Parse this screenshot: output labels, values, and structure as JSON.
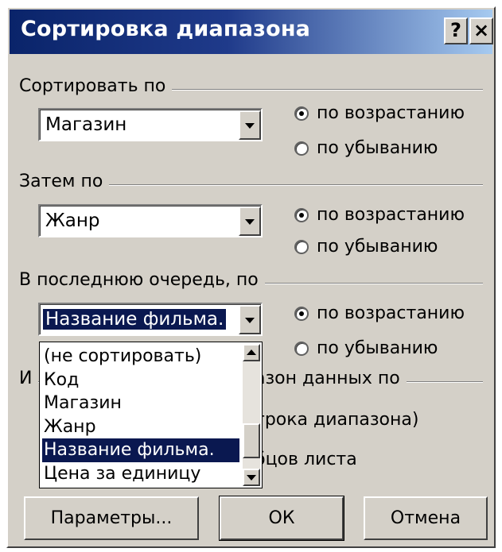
{
  "dialog": {
    "title": "Сортировка диапазона",
    "help_button": "?",
    "close_button": "×"
  },
  "sort_by": {
    "label": "Сортировать по",
    "value": "Магазин",
    "asc": "по возрастанию",
    "desc": "по убыванию",
    "selected": "asc"
  },
  "then_by": {
    "label": "Затем по",
    "value": "Жанр",
    "asc": "по возрастанию",
    "desc": "по убыванию",
    "selected": "asc"
  },
  "finally_by": {
    "label": "В последнюю очередь, по",
    "value": "Название фильма.",
    "asc": "по возрастанию",
    "desc": "по убыванию",
    "selected": "asc"
  },
  "identify": {
    "label_prefix": "И",
    "label_suffix": "азон данных по",
    "option1_fragment": "трока диапазона)",
    "option2_fragment": "бцов листа"
  },
  "dropdown": {
    "items": [
      "(не сортировать)",
      "Код",
      "Магазин",
      "Жанр",
      "Название фильма.",
      "Цена за единицу"
    ],
    "selected_index": 4
  },
  "buttons": {
    "params": "Параметры...",
    "ok": "ОК",
    "cancel": "Отмена"
  },
  "colors": {
    "title_bar": "#0a246a",
    "face": "#d4d0c8",
    "selection": "#0a1850"
  }
}
